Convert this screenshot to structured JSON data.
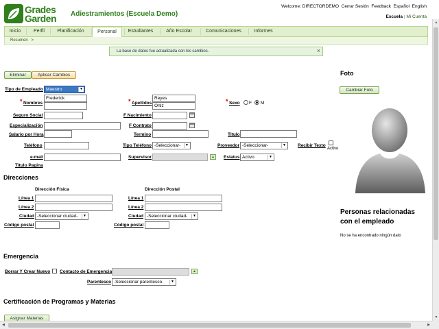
{
  "header": {
    "logo_line1": "Grades",
    "logo_line2": "Garden",
    "title": "Adiestramientos (Escuela Demo)",
    "welcome": "Welcome: DIRECTORDEMO",
    "logout": "Cerrar Sesión",
    "feedback": "Feedback",
    "spanish": "Español",
    "english": "English",
    "school": "Escuela",
    "sep": "|",
    "my_account": "Mi Cuenta"
  },
  "tabs": [
    {
      "label": "Inicio"
    },
    {
      "label": "Perfil"
    },
    {
      "label": "Planificación"
    },
    {
      "label": "Personal"
    },
    {
      "label": "Estudiantes"
    },
    {
      "label": "Año Escolar"
    },
    {
      "label": "Comunicaciones"
    },
    {
      "label": "Informes"
    }
  ],
  "breadcrumb": {
    "item": "Resumen",
    "arrow": ">"
  },
  "notice": {
    "text": "La base de datos fue actualizada con los cambios.",
    "close": "×"
  },
  "actions": {
    "delete": "Eliminar",
    "apply": "Aplicar Cambios"
  },
  "form": {
    "tipo_empleado_label": "Tipo de Empleado",
    "tipo_empleado_value": "Maestro",
    "nombres_label": "Nombres",
    "nombres_value1": "Frederick",
    "nombres_value2": "",
    "apellidos_label": "Apellidos",
    "apellidos_value1": "Reyes",
    "apellidos_value2": "Ortiz",
    "sexo_label": "Sexo",
    "sexo_f": "F",
    "sexo_m": "M",
    "required": "*",
    "seguro_label": "Seguro Social",
    "nacimiento_label": "F Nacimiento",
    "especializacion_label": "Especialización",
    "contrato_label": "F Contrato",
    "salario_label": "Salario por Hora",
    "termino_label": "Termino",
    "titulo_label": "Titulo",
    "telefono_label": "Teléfono",
    "tipo_telefono_label": "Tipo Teléfono",
    "tipo_telefono_value": "-Seleccionar-",
    "proveedor_label": "Proveedor",
    "proveedor_value": "-Seleccionar-",
    "recibir_texto_label": "Recibir Texto",
    "activo_label": "Activo",
    "email_label": "e-mail",
    "supervisor_label": "Supervisor",
    "estatus_label": "Estatus",
    "estatus_value": "Activo",
    "titulo_pagina_label": "Titulo Pagina"
  },
  "direcciones": {
    "title": "Direcciones",
    "fisica": "Dirección Física",
    "postal": "Dirección Postal",
    "linea1": "Línea 1",
    "linea2": "Línea 2",
    "ciudad": "Ciudad",
    "ciudad_value": "-Seleccionar ciudad-",
    "codigo": "Código postal"
  },
  "emergencia": {
    "title": "Emergencia",
    "borrar": "Borrar Y Crear Nuevo",
    "contacto": "Contacto de Emergencia",
    "parentesco": "Parentesco",
    "parentesco_value": "-Seleccionar parentesco-"
  },
  "certificacion": {
    "title": "Certificación de Programas y Materias",
    "assign": "Asignar Materias"
  },
  "foto": {
    "title": "Foto",
    "change": "Cambiar Foto"
  },
  "related": {
    "title_line1": "Personas relacionadas",
    "title_line2": "con el empleado",
    "empty": "No se ha encontrado ningún dato"
  },
  "scroll": {
    "up": "▲",
    "down": "▼",
    "left": "◀",
    "right": "▶"
  },
  "colors": {
    "green_light": "#e2efcf",
    "green_border": "#b9d48c",
    "logo_green": "#2f7f1c"
  }
}
